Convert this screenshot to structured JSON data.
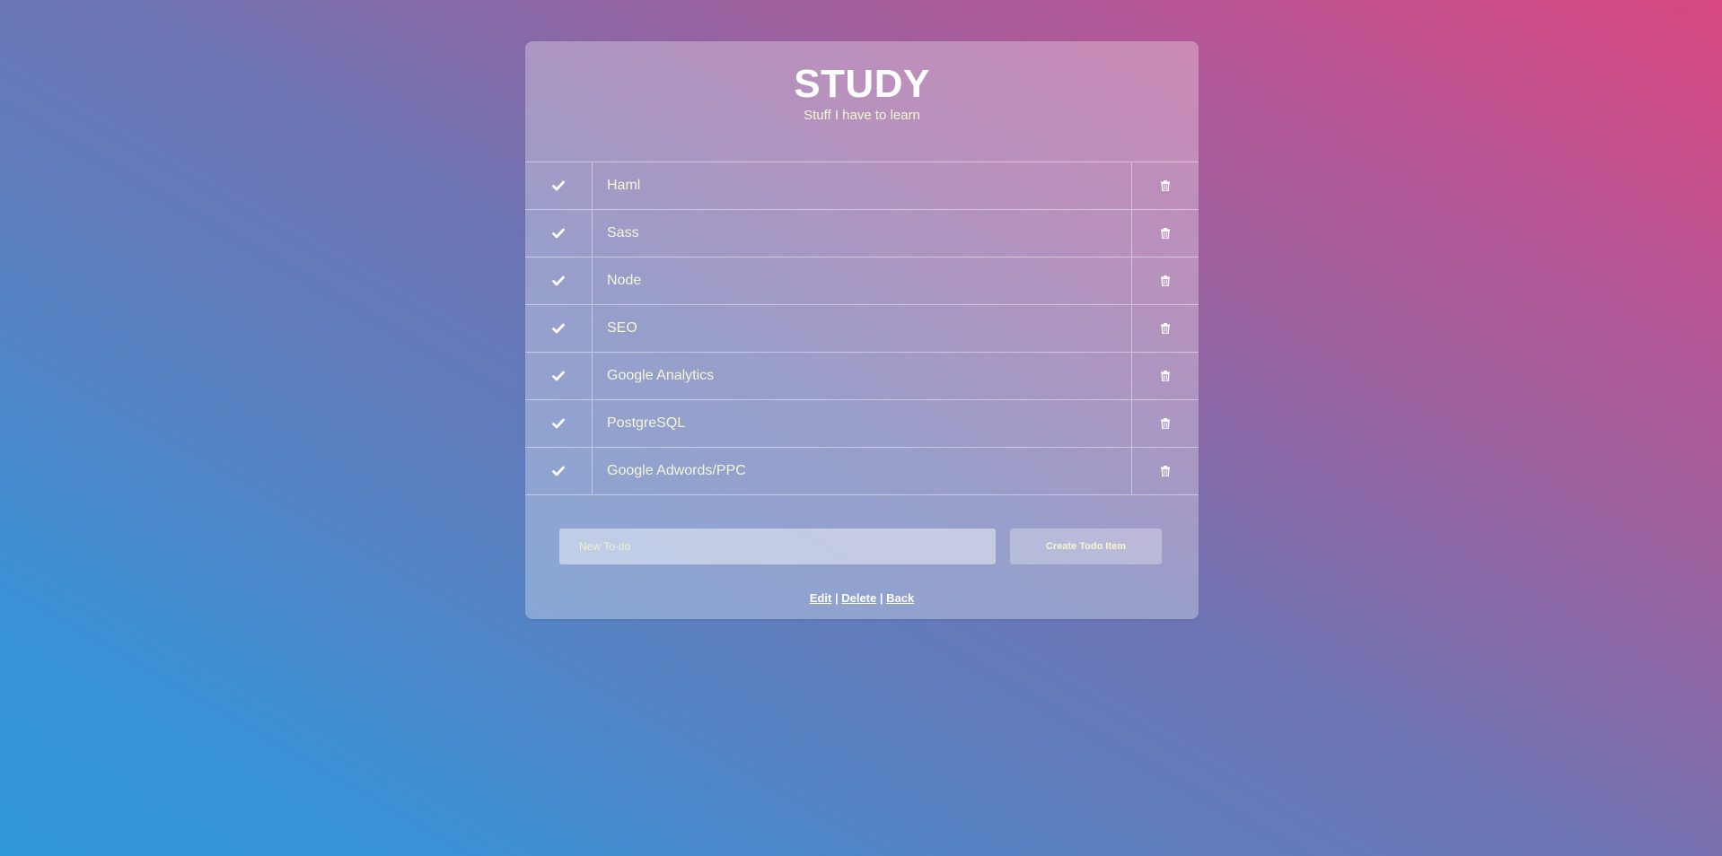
{
  "header": {
    "title": "STUDY",
    "subtitle": "Stuff I have to learn"
  },
  "todos": [
    {
      "text": "Haml",
      "complete_icon": "check-icon",
      "delete_icon": "trash-icon"
    },
    {
      "text": "Sass",
      "complete_icon": "check-icon",
      "delete_icon": "trash-icon"
    },
    {
      "text": "Node",
      "complete_icon": "check-icon",
      "delete_icon": "trash-icon"
    },
    {
      "text": "SEO",
      "complete_icon": "check-icon",
      "delete_icon": "trash-icon"
    },
    {
      "text": "Google Analytics",
      "complete_icon": "check-icon",
      "delete_icon": "trash-icon"
    },
    {
      "text": "PostgreSQL",
      "complete_icon": "check-icon",
      "delete_icon": "trash-icon"
    },
    {
      "text": "Google Adwords/PPC",
      "complete_icon": "check-icon",
      "delete_icon": "trash-icon"
    }
  ],
  "form": {
    "input_placeholder": "New To-do",
    "input_value": "",
    "submit_label": "Create Todo Item"
  },
  "links": {
    "edit": "Edit",
    "delete": "Delete",
    "back": "Back",
    "separator": "|"
  },
  "colors": {
    "gradient_start": "#2f98d9",
    "gradient_mid": "#6e74b3",
    "gradient_end": "#d8477f",
    "text_yellow": "#f4f6d8",
    "text_white": "#ffffff"
  }
}
